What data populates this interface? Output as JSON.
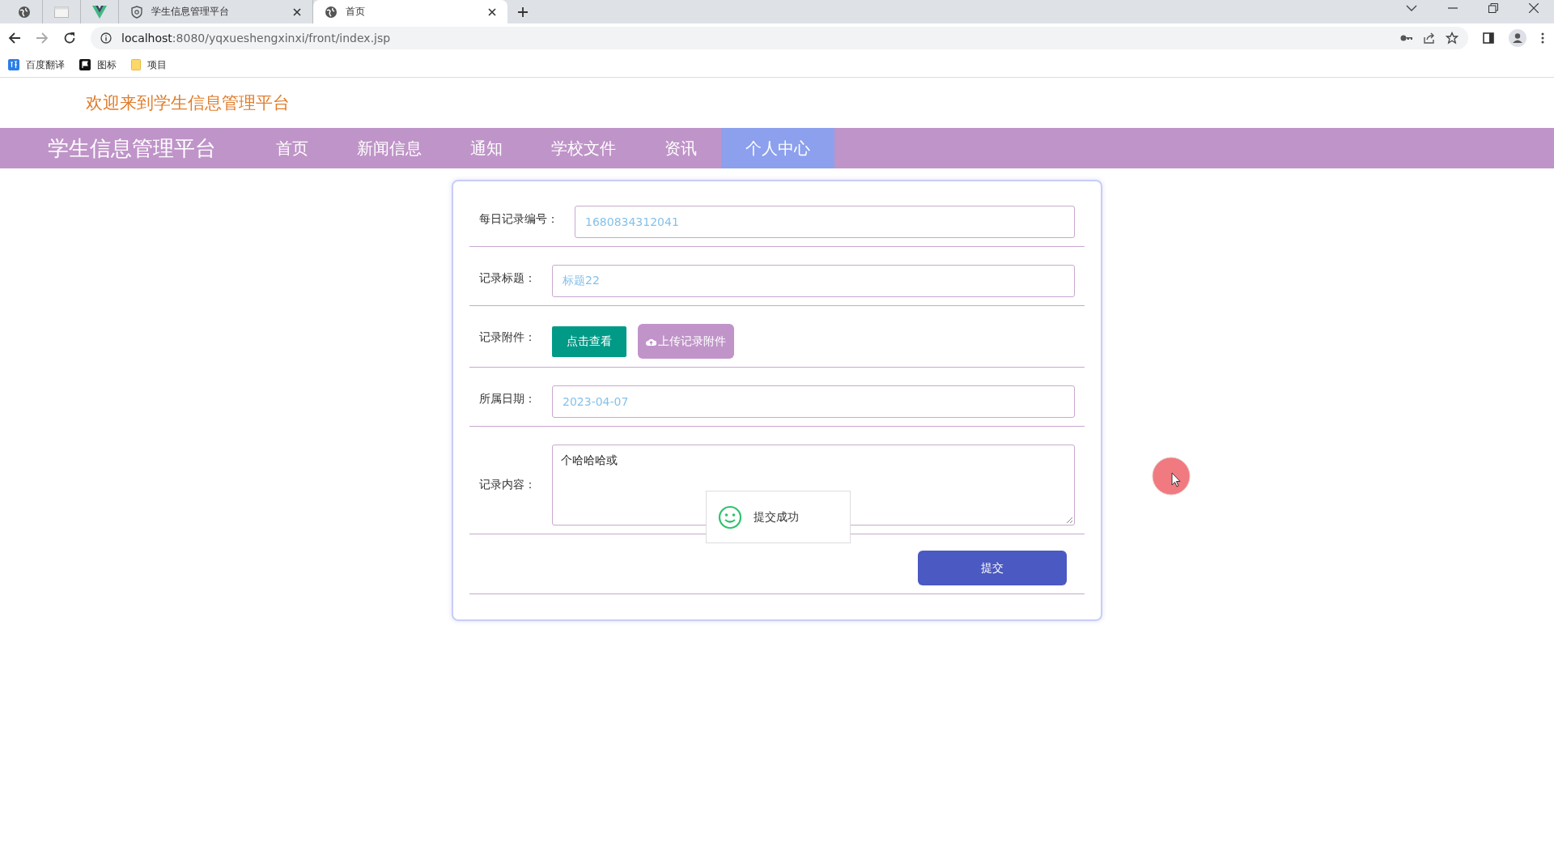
{
  "browser": {
    "tabs": [
      {
        "kind": "icon-globe",
        "selected": false
      },
      {
        "kind": "icon-blank",
        "selected": false
      },
      {
        "kind": "icon-v",
        "selected": false
      },
      {
        "kind": "titled",
        "title": "学生信息管理平台",
        "selected": false
      },
      {
        "kind": "titled",
        "title": "首页",
        "selected": true
      }
    ],
    "address": {
      "host": "localhost",
      "rest": ":8080/yqxueshengxinxi/front/index.jsp"
    },
    "bookmarks": [
      {
        "kind": "translate",
        "label": "百度翻译"
      },
      {
        "kind": "flag",
        "label": "图标"
      },
      {
        "kind": "folder",
        "label": "项目"
      }
    ]
  },
  "welcome": "欢迎来到学生信息管理平台",
  "nav": {
    "brand": "学生信息管理平台",
    "items": [
      {
        "label": "首页",
        "selected": false
      },
      {
        "label": "新闻信息",
        "selected": false
      },
      {
        "label": "通知",
        "selected": false
      },
      {
        "label": "学校文件",
        "selected": false
      },
      {
        "label": "资讯",
        "selected": false
      },
      {
        "label": "个人中心",
        "selected": true
      }
    ]
  },
  "form": {
    "fields": [
      {
        "kind": "input",
        "label": "每日记录编号：",
        "value": "1680834312041"
      },
      {
        "kind": "input",
        "label": "记录标题：",
        "value": "标题22"
      },
      {
        "kind": "buttons",
        "label": "记录附件：",
        "view": "点击查看",
        "upload": "上传记录附件"
      },
      {
        "kind": "input",
        "label": "所属日期：",
        "value": "2023-04-07"
      },
      {
        "kind": "textarea",
        "label": "记录内容：",
        "value": "个哈哈哈或"
      }
    ],
    "submit": "提交"
  },
  "toast": {
    "message": "提交成功"
  }
}
